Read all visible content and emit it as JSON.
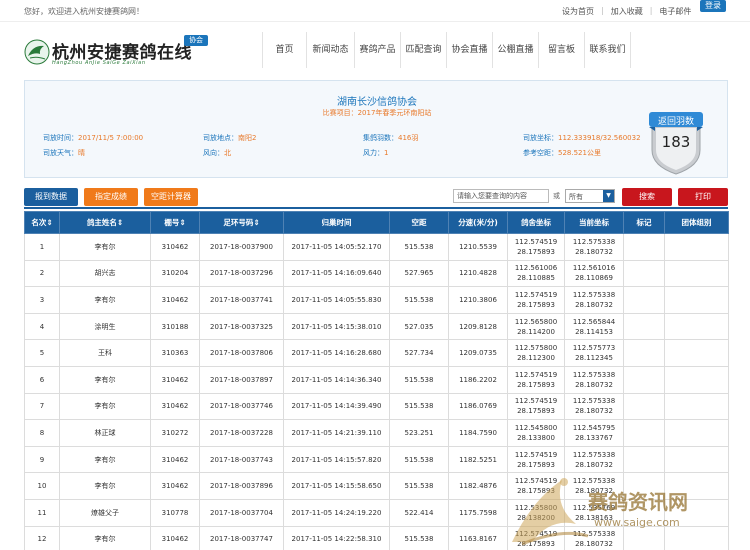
{
  "topbar": {
    "welcome": "您好，欢迎进入杭州安捷赛鸽网！",
    "links": [
      "设为首页",
      "加入收藏",
      "电子邮件"
    ],
    "login": "登录"
  },
  "header": {
    "logo_title": "杭州安捷赛鸽在线",
    "logo_sub": "HangZhou AnJie SaiGe ZaiXian",
    "logo_badge": "协会",
    "nav": [
      "首页",
      "新闻动态",
      "赛鸽产品",
      "匹配查询",
      "协会直播",
      "公棚直播",
      "留言板",
      "联系我们"
    ]
  },
  "race": {
    "title": "湖南长沙信鸽协会",
    "subtitle": "比赛项目：2017年春季元环南阳站",
    "release_time_label": "司放时间：",
    "release_time": "2017/11/5 7:00:00",
    "release_place_label": "司放地点：",
    "release_place": "南阳2",
    "pigeon_count_label": "集鸽羽数：",
    "pigeon_count": "416羽",
    "coords_label": "司放坐标：",
    "coords": "112.333918/32.560032",
    "weather_label": "司放天气：",
    "weather": "晴",
    "wind_dir_label": "风向：",
    "wind_dir": "北",
    "wind_force_label": "风力：",
    "wind_force": "1",
    "ref_distance_label": "参考空距：",
    "ref_distance": "528.521公里",
    "returned_label": "返回羽数",
    "returned": "183"
  },
  "toolbar": {
    "report_btn": "报到数据",
    "designated_btn": "指定成绩",
    "calc_btn": "空距计算器",
    "search_placeholder": "请输入您要查询的内容",
    "or_label": "或",
    "select_value": "所有",
    "search_btn": "搜索",
    "print_btn": "打印"
  },
  "table": {
    "headers": [
      "名次",
      "鸽主姓名",
      "棚号",
      "足环号码",
      "归巢时间",
      "空距",
      "分速(米/分)",
      "鸽舍坐标",
      "当前坐标",
      "标记",
      "团体组别"
    ],
    "rows": [
      [
        "1",
        "李有尔",
        "310462",
        "2017-18-0037900",
        "2017-11-05 14:05:52.170",
        "515.538",
        "1210.5539",
        "112.574519",
        "28.175893",
        "112.575338",
        "28.180732"
      ],
      [
        "2",
        "胡兴志",
        "310204",
        "2017-18-0037296",
        "2017-11-05 14:16:09.640",
        "527.965",
        "1210.4828",
        "112.561006",
        "28.110885",
        "112.561016",
        "28.110869"
      ],
      [
        "3",
        "李有尔",
        "310462",
        "2017-18-0037741",
        "2017-11-05 14:05:55.830",
        "515.538",
        "1210.3806",
        "112.574519",
        "28.175893",
        "112.575338",
        "28.180732"
      ],
      [
        "4",
        "涂明生",
        "310188",
        "2017-18-0037325",
        "2017-11-05 14:15:38.010",
        "527.035",
        "1209.8128",
        "112.565800",
        "28.114200",
        "112.565844",
        "28.114153"
      ],
      [
        "5",
        "王科",
        "310363",
        "2017-18-0037806",
        "2017-11-05 14:16:28.680",
        "527.734",
        "1209.0735",
        "112.575800",
        "28.112300",
        "112.575773",
        "28.112345"
      ],
      [
        "6",
        "李有尔",
        "310462",
        "2017-18-0037897",
        "2017-11-05 14:14:36.340",
        "515.538",
        "1186.2202",
        "112.574519",
        "28.175893",
        "112.575338",
        "28.180732"
      ],
      [
        "7",
        "李有尔",
        "310462",
        "2017-18-0037746",
        "2017-11-05 14:14:39.490",
        "515.538",
        "1186.0769",
        "112.574519",
        "28.175893",
        "112.575338",
        "28.180732"
      ],
      [
        "8",
        "林正球",
        "310272",
        "2017-18-0037228",
        "2017-11-05 14:21:39.110",
        "523.251",
        "1184.7590",
        "112.545800",
        "28.133800",
        "112.545795",
        "28.133767"
      ],
      [
        "9",
        "李有尔",
        "310462",
        "2017-18-0037743",
        "2017-11-05 14:15:57.820",
        "515.538",
        "1182.5251",
        "112.574519",
        "28.175893",
        "112.575338",
        "28.180732"
      ],
      [
        "10",
        "李有尔",
        "310462",
        "2017-18-0037896",
        "2017-11-05 14:15:58.650",
        "515.538",
        "1182.4876",
        "112.574519",
        "28.175893",
        "112.575338",
        "28.180732"
      ],
      [
        "11",
        "燎雄父子",
        "310778",
        "2017-18-0037704",
        "2017-11-05 14:24:19.220",
        "522.414",
        "1175.7598",
        "112.535800",
        "28.138200",
        "112.535769",
        "28.138163"
      ],
      [
        "12",
        "李有尔",
        "310462",
        "2017-18-0037747",
        "2017-11-05 14:22:58.310",
        "515.538",
        "1163.8167",
        "112.574519",
        "28.175893",
        "112.575338",
        "28.180732"
      ]
    ]
  },
  "watermark": {
    "title": "赛鸽资讯网",
    "url": "www.saige.com"
  }
}
